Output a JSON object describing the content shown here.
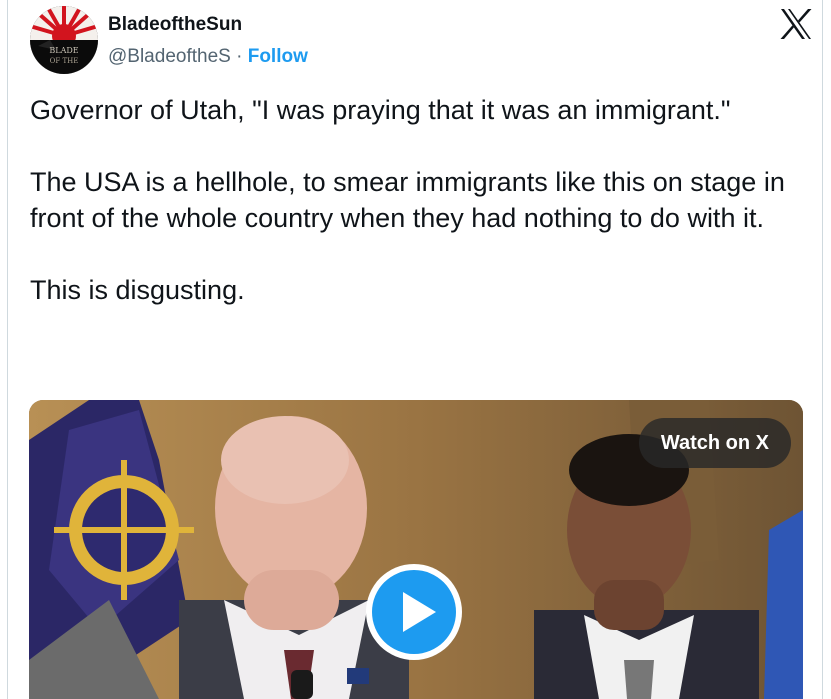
{
  "author": {
    "display_name": "BladeoftheSun",
    "handle": "@BladeoftheS",
    "separator": "·",
    "follow_label": "Follow",
    "avatar_text": [
      "BLADE",
      "OF THE"
    ]
  },
  "post": {
    "paragraphs": [
      "Governor of Utah, \"I was praying that it was an immigrant.\"",
      "The USA is a hellhole, to smear immigrants like this on stage in front of the whole country when they had nothing to do with it.",
      "This is disgusting."
    ]
  },
  "media": {
    "watch_label": "Watch on X"
  },
  "icons": {
    "platform": "x-logo-icon",
    "play": "play-icon"
  },
  "colors": {
    "accent": "#1d9bf0",
    "text": "#0f1419",
    "secondary": "#536471"
  }
}
